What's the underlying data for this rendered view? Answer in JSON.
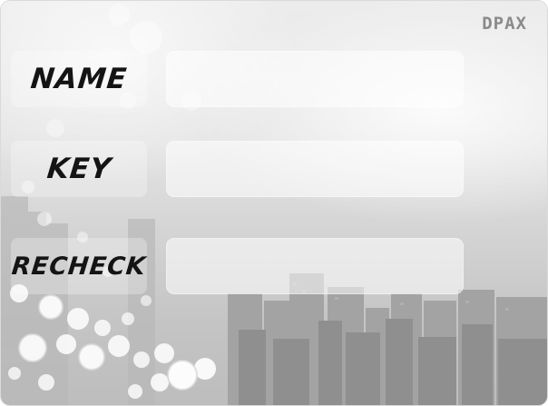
{
  "brand": {
    "text": "DPAX"
  },
  "form": {
    "fields": [
      {
        "label": "NAME",
        "value": ""
      },
      {
        "label": "KEY",
        "value": ""
      },
      {
        "label": "RECHECK",
        "value": ""
      }
    ]
  },
  "colors": {
    "label_text": "#141414",
    "brand_text": "#8a8a8a",
    "bokeh": "#ffffff",
    "skyline": "#9d9d9d"
  }
}
